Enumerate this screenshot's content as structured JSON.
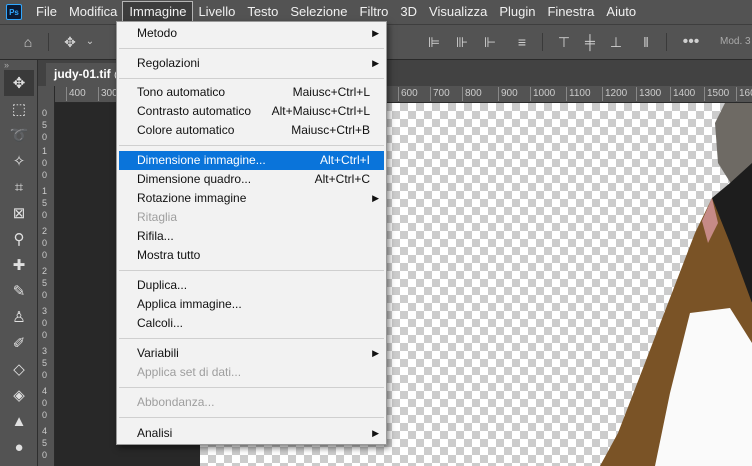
{
  "menubar": {
    "logo": "Ps",
    "items": [
      "File",
      "Modifica",
      "Immagine",
      "Livello",
      "Testo",
      "Selezione",
      "Filtro",
      "3D",
      "Visualizza",
      "Plugin",
      "Finestra",
      "Aiuto"
    ],
    "active": "Immagine"
  },
  "options_bar": {
    "right_label": "Mod. 3"
  },
  "document_tab": {
    "title": "judy-01.tif @"
  },
  "toolbar": {
    "collapse_glyph": "»"
  },
  "ruler": {
    "h_labels": [
      "400",
      "300",
      "600",
      "700",
      "800",
      "900",
      "1000",
      "1100",
      "1200",
      "1300",
      "1400",
      "1500",
      "1600"
    ],
    "v_labels": [
      "0",
      "5",
      "0",
      "1",
      "0",
      "0",
      "1",
      "5",
      "0",
      "2",
      "0",
      "0",
      "2",
      "5",
      "0",
      "3",
      "0",
      "0",
      "3",
      "5",
      "0",
      "4",
      "0",
      "0",
      "4",
      "5",
      "0"
    ]
  },
  "image_menu": {
    "items": [
      {
        "label": "Metodo",
        "shortcut": "",
        "submenu": true
      },
      {
        "label": "Regolazioni",
        "shortcut": "",
        "submenu": true
      },
      {
        "label": "Tono automatico",
        "shortcut": "Maiusc+Ctrl+L"
      },
      {
        "label": "Contrasto automatico",
        "shortcut": "Alt+Maiusc+Ctrl+L"
      },
      {
        "label": "Colore automatico",
        "shortcut": "Maiusc+Ctrl+B"
      },
      {
        "label": "Dimensione immagine...",
        "shortcut": "Alt+Ctrl+I",
        "highlighted": true
      },
      {
        "label": "Dimensione quadro...",
        "shortcut": "Alt+Ctrl+C"
      },
      {
        "label": "Rotazione immagine",
        "shortcut": "",
        "submenu": true
      },
      {
        "label": "Ritaglia",
        "shortcut": "",
        "disabled": true
      },
      {
        "label": "Rifila...",
        "shortcut": ""
      },
      {
        "label": "Mostra tutto",
        "shortcut": ""
      },
      {
        "label": "Duplica...",
        "shortcut": ""
      },
      {
        "label": "Applica immagine...",
        "shortcut": ""
      },
      {
        "label": "Calcoli...",
        "shortcut": ""
      },
      {
        "label": "Variabili",
        "shortcut": "",
        "submenu": true
      },
      {
        "label": "Applica set di dati...",
        "shortcut": "",
        "disabled": true
      },
      {
        "label": "Abbondanza...",
        "shortcut": "",
        "disabled": true
      },
      {
        "label": "Analisi",
        "shortcut": "",
        "submenu": true
      }
    ]
  },
  "colors": {
    "highlight": "#0a74da",
    "panel": "#535353",
    "canvas_bg": "#282828"
  }
}
